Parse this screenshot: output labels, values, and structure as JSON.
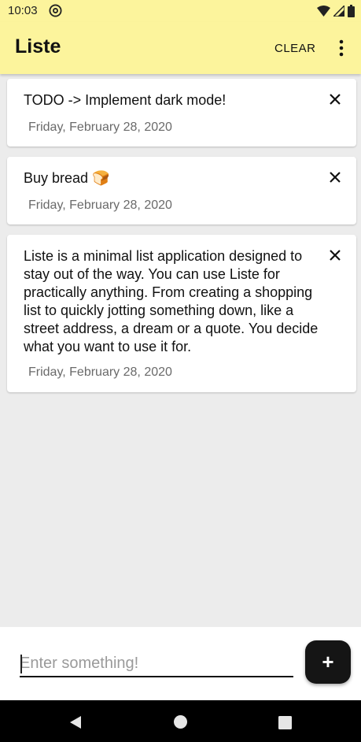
{
  "status_bar": {
    "time": "10:03",
    "icons": [
      "at-sign-icon",
      "wifi-icon",
      "cell-signal-icon",
      "battery-icon"
    ]
  },
  "app_bar": {
    "title": "Liste",
    "clear_label": "CLEAR",
    "menu_icon": "more-vertical-icon",
    "background": "#fcf49c"
  },
  "items": [
    {
      "text": "TODO -> Implement dark mode!",
      "date": "Friday, February 28, 2020"
    },
    {
      "text": "Buy bread 🍞",
      "date": "Friday, February 28, 2020"
    },
    {
      "text": "Liste is a minimal list application designed to stay out of the way. You can use Liste for practically anything. From creating a shopping list to quickly jotting something down, like a street address, a dream or a quote. You decide what you want to use it for.",
      "date": "Friday, February 28, 2020"
    }
  ],
  "input": {
    "placeholder": "Enter something!",
    "value": ""
  },
  "fab": {
    "label": "+",
    "background": "#151515"
  },
  "nav_bar": {
    "icons": [
      "back-icon",
      "home-icon",
      "recents-icon"
    ]
  }
}
